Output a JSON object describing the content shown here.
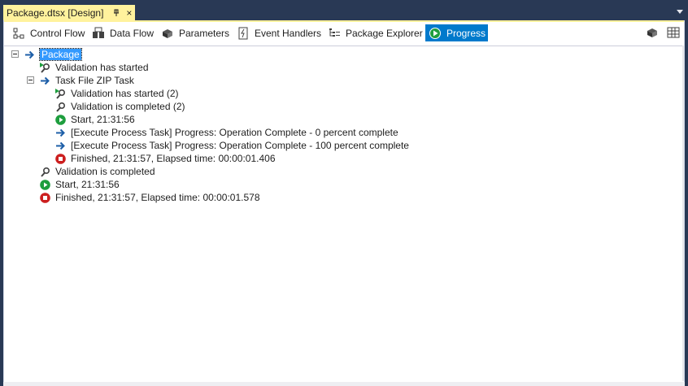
{
  "document_tab": {
    "title": "Package.dtsx [Design]",
    "pin_icon": "pin-icon",
    "close_glyph": "×"
  },
  "toolbar": {
    "tabs": [
      {
        "label": "Control Flow",
        "icon": "control-flow-icon"
      },
      {
        "label": "Data Flow",
        "icon": "data-flow-icon"
      },
      {
        "label": "Parameters",
        "icon": "parameters-icon"
      },
      {
        "label": "Event Handlers",
        "icon": "event-handlers-icon"
      },
      {
        "label": "Package Explorer",
        "icon": "package-explorer-icon"
      },
      {
        "label": "Progress",
        "icon": "progress-play-icon",
        "active": true
      }
    ],
    "right_icons": [
      "package-icon",
      "grid-icon"
    ]
  },
  "progress_tree": {
    "root": {
      "label": "Package"
    },
    "items": [
      {
        "label": "Validation has started",
        "icon": "validation-start-icon"
      },
      {
        "label": "Task File ZIP Task",
        "icon": "arrow-right-icon"
      },
      {
        "label": "Validation has started (2)",
        "icon": "validation-start-icon"
      },
      {
        "label": "Validation is completed (2)",
        "icon": "validation-complete-icon"
      },
      {
        "label": "Start, 21:31:56",
        "icon": "start-green-icon"
      },
      {
        "label": "[Execute Process Task] Progress: Operation Complete - 0 percent complete",
        "icon": "arrow-right-icon"
      },
      {
        "label": "[Execute Process Task] Progress: Operation Complete - 100 percent complete",
        "icon": "arrow-right-icon"
      },
      {
        "label": "Finished, 21:31:57, Elapsed time: 00:00:01.406",
        "icon": "stop-red-icon"
      },
      {
        "label": "Validation is completed",
        "icon": "validation-complete-icon"
      },
      {
        "label": "Start, 21:31:56",
        "icon": "start-green-icon"
      },
      {
        "label": "Finished, 21:31:57, Elapsed time: 00:00:01.578",
        "icon": "stop-red-icon"
      }
    ]
  },
  "colors": {
    "chrome": "#293955",
    "active_tab": "#fff29d",
    "selection": "#3399ff",
    "accent": "#007acc",
    "start_green": "#1e9e3e",
    "stop_red": "#cc1f1f",
    "arrow_blue": "#1e5fa8"
  }
}
